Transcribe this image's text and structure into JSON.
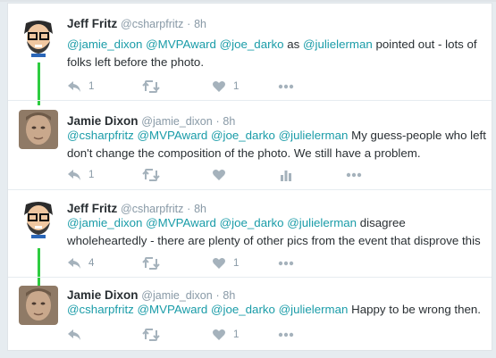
{
  "tweets": [
    {
      "name": "Jeff Fritz",
      "handle": "@csharpfritz",
      "sep": "·",
      "time": "8h",
      "avatar": "cartoon-avatar",
      "text": [
        {
          "t": "@jamie_dixon",
          "m": true
        },
        {
          "t": " ",
          "m": false
        },
        {
          "t": "@MVPAward",
          "m": true
        },
        {
          "t": " ",
          "m": false
        },
        {
          "t": "@joe_darko",
          "m": true
        },
        {
          "t": " as ",
          "m": false
        },
        {
          "t": "@julielerman",
          "m": true
        },
        {
          "t": " pointed out - lots of folks left before the photo.",
          "m": false
        }
      ],
      "reply_count": "1",
      "retweet_count": "",
      "like_count": "1"
    },
    {
      "name": "Jamie Dixon",
      "handle": "@jamie_dixon",
      "sep": "·",
      "time": "8h",
      "avatar": "photo-avatar",
      "text": [
        {
          "t": "@csharpfritz",
          "m": true
        },
        {
          "t": " ",
          "m": false
        },
        {
          "t": "@MVPAward",
          "m": true
        },
        {
          "t": " ",
          "m": false
        },
        {
          "t": "@joe_darko",
          "m": true
        },
        {
          "t": " ",
          "m": false
        },
        {
          "t": "@julielerman",
          "m": true
        },
        {
          "t": " My guess-people who left don't change the composition of the photo.  We still have a problem.",
          "m": false
        }
      ],
      "reply_count": "1",
      "retweet_count": "",
      "like_count": ""
    },
    {
      "name": "Jeff Fritz",
      "handle": "@csharpfritz",
      "sep": "·",
      "time": "8h",
      "avatar": "cartoon-avatar",
      "text": [
        {
          "t": "@jamie_dixon",
          "m": true
        },
        {
          "t": " ",
          "m": false
        },
        {
          "t": "@MVPAward",
          "m": true
        },
        {
          "t": " ",
          "m": false
        },
        {
          "t": "@joe_darko",
          "m": true
        },
        {
          "t": " ",
          "m": false
        },
        {
          "t": "@julielerman",
          "m": true
        },
        {
          "t": " disagree wholeheartedly - there are plenty of other pics from the event that disprove this",
          "m": false
        }
      ],
      "reply_count": "4",
      "retweet_count": "",
      "like_count": "1"
    },
    {
      "name": "Jamie Dixon",
      "handle": "@jamie_dixon",
      "sep": "·",
      "time": "8h",
      "avatar": "photo-avatar",
      "text": [
        {
          "t": "@csharpfritz",
          "m": true
        },
        {
          "t": " ",
          "m": false
        },
        {
          "t": "@MVPAward",
          "m": true
        },
        {
          "t": " ",
          "m": false
        },
        {
          "t": "@joe_darko",
          "m": true
        },
        {
          "t": " ",
          "m": false
        },
        {
          "t": "@julielerman",
          "m": true
        },
        {
          "t": " Happy to be wrong then.",
          "m": false
        }
      ],
      "reply_count": "",
      "retweet_count": "",
      "like_count": "1"
    }
  ],
  "colors": {
    "mention": "#1a9ca8",
    "thread": "#2ecc40",
    "icon": "#a5b2bc"
  }
}
